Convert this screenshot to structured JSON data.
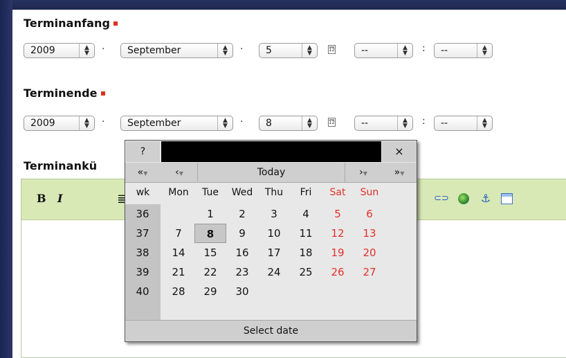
{
  "start": {
    "label": "Terminanfang",
    "year": "2009",
    "month": "September",
    "day": "5",
    "hour": "--",
    "minute": "--"
  },
  "end": {
    "label": "Terminende",
    "year": "2009",
    "month": "September",
    "day": "8",
    "hour": "--",
    "minute": "--"
  },
  "announce_label": "Terminankü",
  "separators": {
    "dot": "·",
    "colon": ":"
  },
  "calendar_icon_text": "12",
  "editor": {
    "bold": "B",
    "italic": "I",
    "align_icon": "≣"
  },
  "calendar": {
    "help": "?",
    "close": "×",
    "nav": {
      "prev_year": "«",
      "prev_month": "‹",
      "today": "Today",
      "next_month": "›",
      "next_year": "»"
    },
    "headers": [
      "wk",
      "Mon",
      "Tue",
      "Wed",
      "Thu",
      "Fri",
      "Sat",
      "Sun"
    ],
    "weeks": [
      {
        "wk": "36",
        "days": [
          "",
          "1",
          "2",
          "3",
          "4",
          "5",
          "6"
        ]
      },
      {
        "wk": "37",
        "days": [
          "7",
          "8",
          "9",
          "10",
          "11",
          "12",
          "13"
        ]
      },
      {
        "wk": "38",
        "days": [
          "14",
          "15",
          "16",
          "17",
          "18",
          "19",
          "20"
        ]
      },
      {
        "wk": "39",
        "days": [
          "21",
          "22",
          "23",
          "24",
          "25",
          "26",
          "27"
        ]
      },
      {
        "wk": "40",
        "days": [
          "28",
          "29",
          "30",
          "",
          "",
          "",
          ""
        ]
      }
    ],
    "selected_day": "8",
    "footer": "Select date",
    "weekend_color": "#e0302a"
  }
}
